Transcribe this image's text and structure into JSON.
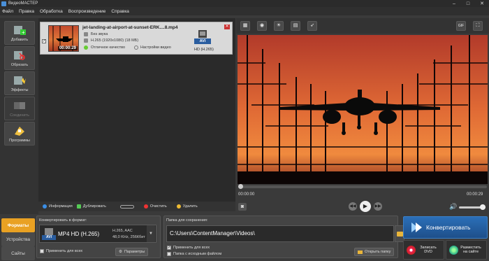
{
  "window": {
    "title": "ВидеоМАСТЕР",
    "minimize": "–",
    "maximize": "□",
    "close": "✕"
  },
  "menu": [
    "Файл",
    "Правка",
    "Обработка",
    "Воспроизведение",
    "Справка"
  ],
  "tools": [
    {
      "label": "Добавить",
      "icon": "add-film-icon",
      "enabled": true
    },
    {
      "label": "Обрезать",
      "icon": "scissors-film-icon",
      "enabled": true
    },
    {
      "label": "Эффекты",
      "icon": "effects-film-icon",
      "enabled": true
    },
    {
      "label": "Соединить",
      "icon": "join-film-icon",
      "enabled": false
    },
    {
      "label": "Программы",
      "icon": "programs-icon",
      "enabled": true
    }
  ],
  "file": {
    "name": "jet-landing-at-airport-at-sunset-ERK....8.mp4",
    "duration": "00:00:29",
    "audio": "Без звука",
    "codec": "H.265 (1920x1080) (18 МБ)",
    "quality": "Отличное качество",
    "settings": "Настройки видео",
    "format_badge": "AVI",
    "format_label": "HD (H.265)",
    "checked": true
  },
  "listbar": {
    "info": "Информация",
    "duplicate": "Дублировать",
    "clear": "Очистить",
    "delete": "Удалить"
  },
  "player": {
    "time_current": "00:00:00",
    "time_total": "00:00:29",
    "progress": 0,
    "gif_label": "GIF"
  },
  "bottom": {
    "tabs": [
      {
        "label": "Форматы",
        "active": true
      },
      {
        "label": "Устройства",
        "active": false
      },
      {
        "label": "Сайты",
        "active": false
      }
    ],
    "convert_label": "Конвертировать в формат:",
    "format_badge": "AVI",
    "format_name": "MP4 HD (H.265)",
    "format_info1": "H.265, AAC",
    "format_info2": "48,0 KHz, 256Кбит",
    "apply_all": "Применить для всех",
    "params": "Параметры",
    "folder_label": "Папка для сохранения:",
    "folder_path": "C:\\Users\\ContentManager\\Videos\\",
    "apply_all2": "Применить для всех",
    "source_folder": "Папка с исходным файлом",
    "open_folder": "Открыть папку",
    "convert": "Конвертировать",
    "burn_dvd": "Записать DVD",
    "publish": "Разместить на сайте"
  }
}
